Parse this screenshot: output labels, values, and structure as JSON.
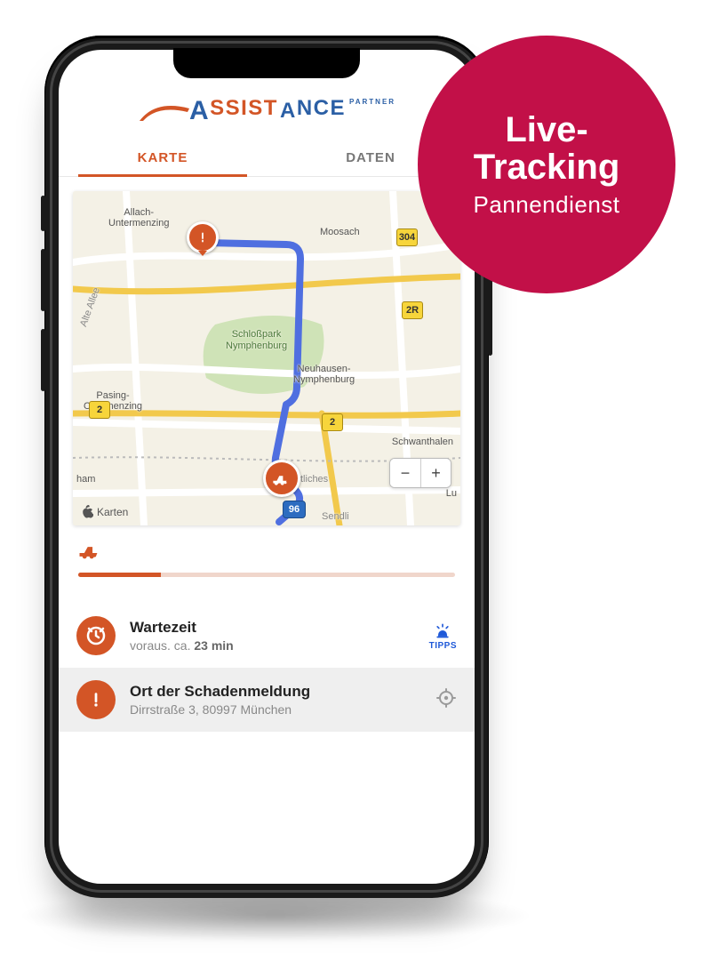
{
  "brand": {
    "name_left": "SSIST",
    "big_a": "A",
    "name_right": "NCE",
    "sup": "PARTNER"
  },
  "colors": {
    "accent": "#d35526",
    "link_blue": "#1f59d8",
    "promo": "#c21048"
  },
  "tabs": {
    "karte": "KARTE",
    "daten": "DATEN",
    "active": "karte"
  },
  "map": {
    "attribution": "Karten",
    "zoom_out": "−",
    "zoom_in": "+",
    "labels": {
      "allach": "Allach-\nUntermenzing",
      "moosach": "Moosach",
      "schlosspark": "Schloßpark\nNymphenburg",
      "neuhausen": "Neuhausen-\nNymphenburg",
      "pasing": "Pasing-\nObermenzing",
      "schwan": "Schwanthalen",
      "ham": "ham",
      "allee": "Alte Allee",
      "lu": "Lu",
      "sendl": "Sendli",
      "tliches": "tliches"
    },
    "shields": {
      "r304": "304",
      "r2a": "2",
      "r2b": "2",
      "r2r": "2R",
      "r96": "96"
    }
  },
  "progress": {
    "value": 0.22
  },
  "rows": {
    "wait": {
      "title": "Wartezeit",
      "sub_prefix": "voraus. ca. ",
      "sub_strong": "23 min"
    },
    "location": {
      "title": "Ort der Schadenmeldung",
      "sub": "Dirrstraße 3, 80997 München"
    },
    "tipps": "TIPPS"
  },
  "promo": {
    "line1": "Live-",
    "line2": "Tracking",
    "sub": "Pannendienst"
  }
}
